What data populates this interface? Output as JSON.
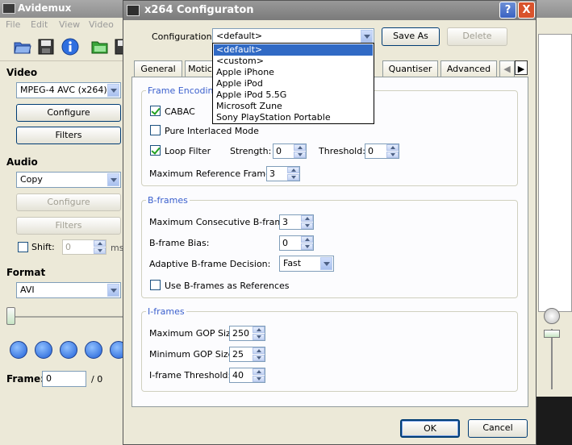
{
  "avidemux": {
    "title": "Avidemux",
    "menu": [
      "File",
      "Edit",
      "View",
      "Video"
    ],
    "video": {
      "heading": "Video",
      "codec": "MPEG-4 AVC (x264)",
      "configure": "Configure",
      "filters": "Filters"
    },
    "audio": {
      "heading": "Audio",
      "codec": "Copy",
      "configure": "Configure",
      "filters": "Filters",
      "shift_label": "Shift:",
      "shift_value": "0",
      "shift_unit": "ms"
    },
    "format": {
      "heading": "Format",
      "value": "AVI"
    },
    "frame": {
      "label": "Frame:",
      "value": "0",
      "total": "/ 0"
    }
  },
  "dialog": {
    "title": "x264 Configuraton",
    "help_btn": "?",
    "close_btn": "X",
    "config_label": "Configuration:",
    "config_value": "<default>",
    "save_as": "Save As",
    "delete": "Delete",
    "dropdown_options": [
      "<default>",
      "<custom>",
      "Apple iPhone",
      "Apple iPod",
      "Apple iPod 5.5G",
      "Microsoft Zune",
      "Sony PlayStation Portable"
    ],
    "tabs": [
      "General",
      "Motic",
      "Quantiser",
      "Advanced"
    ],
    "tab_arrow_left": "◀",
    "tab_arrow_right": "▶",
    "frame_encoding": {
      "title": "Frame Encoding",
      "cabac": "CABAC",
      "pure_interlaced": "Pure Interlaced Mode",
      "loop_filter": "Loop Filter",
      "strength_label": "Strength:",
      "strength_value": "0",
      "threshold_label": "Threshold:",
      "threshold_value": "0",
      "max_ref_label": "Maximum Reference Frames:",
      "max_ref_value": "3"
    },
    "bframes": {
      "title": "B-frames",
      "max_consec_label": "Maximum Consecutive B-frames:",
      "max_consec_value": "3",
      "bias_label": "B-frame Bias:",
      "bias_value": "0",
      "adaptive_label": "Adaptive B-frame Decision:",
      "adaptive_value": "Fast",
      "use_as_ref": "Use B-frames as References"
    },
    "iframes": {
      "title": "I-frames",
      "max_gop_label": "Maximum GOP Size:",
      "max_gop_value": "250",
      "min_gop_label": "Minimum GOP Size:",
      "min_gop_value": "25",
      "threshold_label": "I-frame Threshold:",
      "threshold_value": "40"
    },
    "ok": "OK",
    "cancel": "Cancel"
  },
  "colors": {
    "selection": "#316ac5",
    "group_title": "#3a5fcd",
    "close_red": "#d9532c"
  }
}
